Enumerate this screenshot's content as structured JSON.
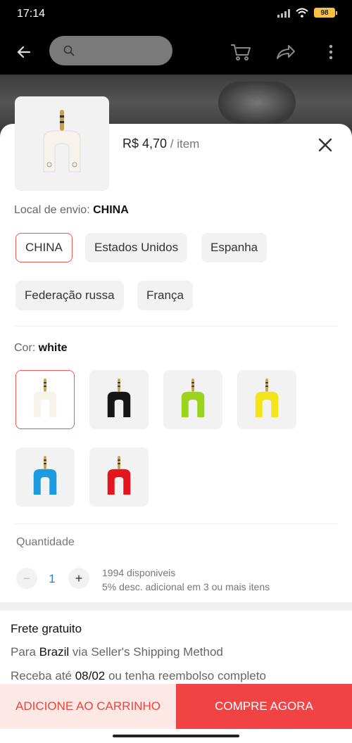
{
  "status": {
    "time": "17:14",
    "battery": "98"
  },
  "search": {
    "placeholder": ""
  },
  "product": {
    "price": "R$ 4,70",
    "unit": " / item"
  },
  "shipping_origin": {
    "label": "Local de envio: ",
    "value": "CHINA",
    "options": [
      "CHINA",
      "Estados Unidos",
      "Espanha",
      "Federação russa",
      "França"
    ],
    "selected": "CHINA"
  },
  "color": {
    "label": "Cor: ",
    "value": "white",
    "options": [
      {
        "name": "white",
        "hex": "#f7f3ea"
      },
      {
        "name": "black",
        "hex": "#161616"
      },
      {
        "name": "green",
        "hex": "#9bd41c"
      },
      {
        "name": "yellow",
        "hex": "#f2e51b"
      },
      {
        "name": "blue",
        "hex": "#1c9be0"
      },
      {
        "name": "red",
        "hex": "#e3161f"
      }
    ]
  },
  "quantity": {
    "label": "Quantidade",
    "value": "1",
    "minus": "−",
    "plus": "+",
    "available": "1994 disponiveis",
    "discount": "5% desc. adicional em 3 ou mais itens"
  },
  "shipping": {
    "title": "Frete gratuito",
    "line1_prefix": "Para ",
    "line1_country": "Brazil",
    "line1_suffix": " via Seller's Shipping Method",
    "line2_prefix": "Receba até ",
    "line2_date": "08/02",
    "line2_suffix": " ou tenha reembolso completo"
  },
  "actions": {
    "add_to_cart": "ADICIONE AO CARRINHO",
    "buy_now": "COMPRE AGORA"
  },
  "colors": {
    "accent": "#f14343",
    "selected_border": "#e85a4f",
    "link": "#2a82c9"
  }
}
